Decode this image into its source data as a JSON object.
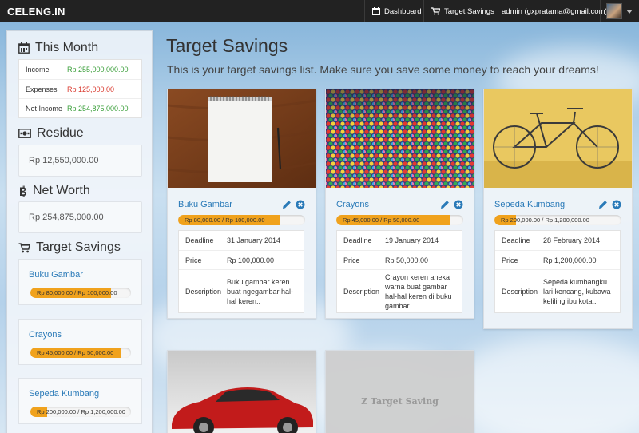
{
  "navbar": {
    "brand": "CELENG.IN",
    "dashboard_label": "Dashboard",
    "target_savings_label": "Target Savings",
    "user_label": "admin (gxpratama@gmail.com)"
  },
  "sidebar": {
    "this_month": {
      "heading": "This Month",
      "icon": "calendar-icon",
      "rows": [
        {
          "label": "Income",
          "value": "Rp 255,000,000.00",
          "color": "#3a9f3a"
        },
        {
          "label": "Expenses",
          "value": "Rp 125,000.00",
          "color": "#d9362b"
        },
        {
          "label": "Net Income",
          "value": "Rp 254,875,000.00",
          "color": "#3a9f3a"
        }
      ]
    },
    "residue": {
      "heading": "Residue",
      "icon": "money-icon",
      "value": "Rp 12,550,000.00"
    },
    "net_worth": {
      "heading": "Net Worth",
      "icon": "bitcoin-icon",
      "value": "Rp 254,875,000.00"
    },
    "target_savings": {
      "heading": "Target Savings",
      "icon": "cart-icon",
      "items": [
        {
          "name": "Buku Gambar",
          "progress_text": "Rp 80,000.00 / Rp 100,000.00",
          "progress": 0.8
        },
        {
          "name": "Crayons",
          "progress_text": "Rp 45,000.00 / Rp 50,000.00",
          "progress": 0.9
        },
        {
          "name": "Sepeda Kumbang",
          "progress_text": "Rp 200,000.00 / Rp 1,200,000.00",
          "progress": 0.1667
        }
      ]
    }
  },
  "main": {
    "title": "Target Savings",
    "subtitle": "This is your target savings list. Make sure you save some money to reach your dreams!",
    "labels": {
      "deadline": "Deadline",
      "price": "Price",
      "description": "Description"
    },
    "targets": [
      {
        "name": "Buku Gambar",
        "image": "sketchbook-photo",
        "progress_text": "Rp 80,000.00 / Rp 100,000.00",
        "progress": 0.8,
        "deadline": "31 January 2014",
        "price": "Rp 100,000.00",
        "description": "Buku gambar keren buat ngegambar hal-hal keren.."
      },
      {
        "name": "Crayons",
        "image": "crayons-photo",
        "progress_text": "Rp 45,000.00 / Rp 50,000.00",
        "progress": 0.9,
        "deadline": "19 January 2014",
        "price": "Rp 50,000.00",
        "description": "Crayon keren aneka warna buat gambar hal-hal keren di buku gambar.."
      },
      {
        "name": "Sepeda Kumbang",
        "image": "bicycle-photo",
        "progress_text": "Rp 200,000.00 / Rp 1,200,000.00",
        "progress": 0.1667,
        "deadline": "28 February 2014",
        "price": "Rp 1,200,000.00",
        "description": "Sepeda kumbangku lari kencang, kubawa keliling ibu kota.."
      }
    ],
    "bottom_cards": [
      {
        "image": "red-car-photo"
      },
      {
        "placeholder_text": "Z Target Saving"
      }
    ]
  },
  "colors": {
    "accent": "#2a7ab8",
    "progress": "#f0a21d",
    "positive": "#3a9f3a",
    "negative": "#d9362b",
    "navbar": "#222222"
  }
}
